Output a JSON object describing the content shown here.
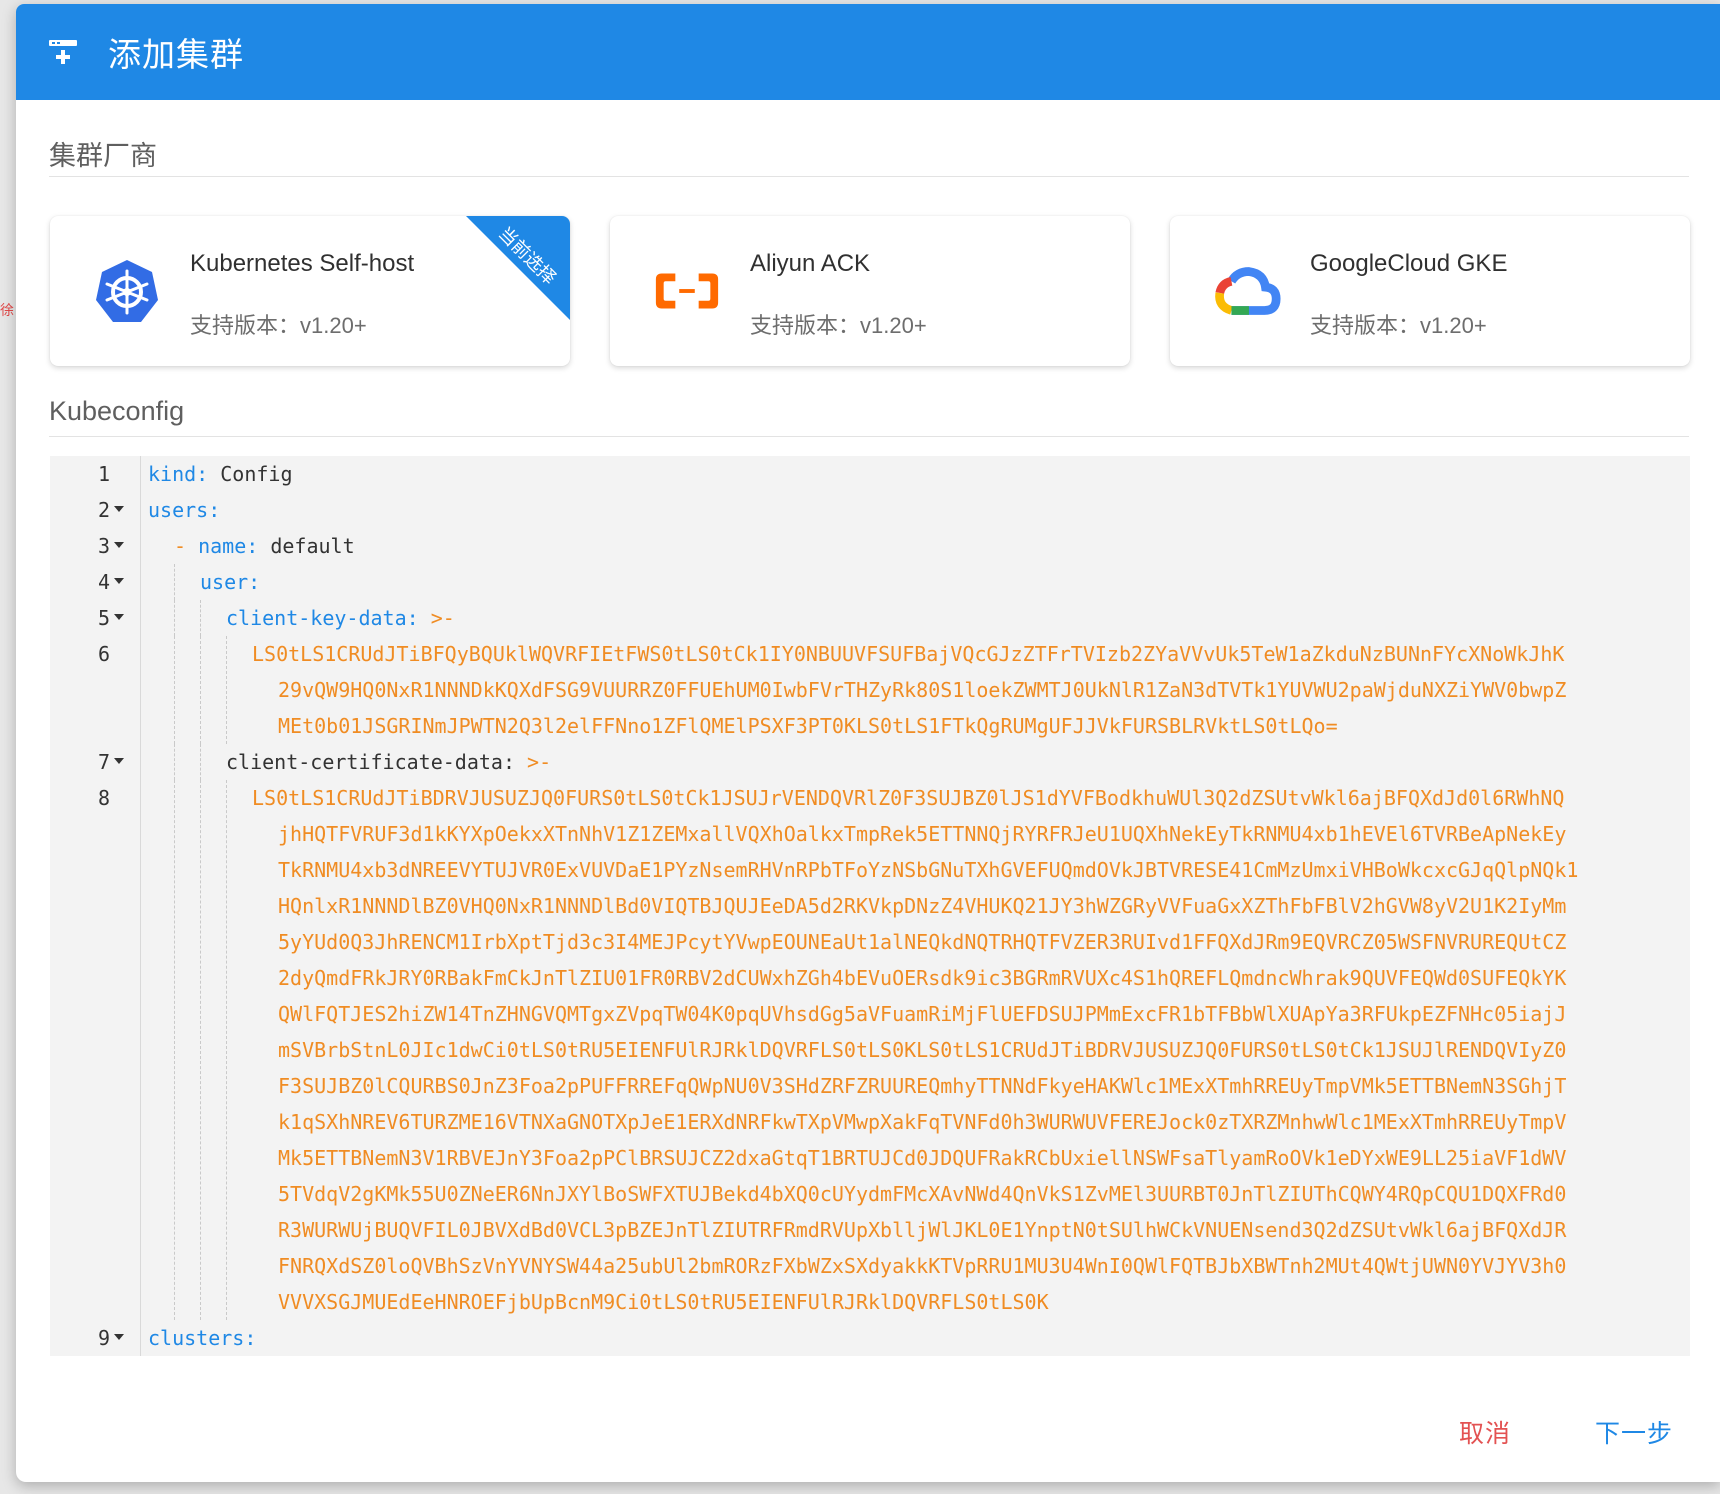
{
  "dialog": {
    "title": "添加集群",
    "title_icon": "add-server-icon"
  },
  "vendor_section": {
    "label": "集群厂商"
  },
  "vendors": [
    {
      "name": "Kubernetes Self-host",
      "version": "支持版本：v1.20+",
      "icon": "kubernetes-icon",
      "selected": true,
      "badge": "当前选择"
    },
    {
      "name": "Aliyun ACK",
      "version": "支持版本：v1.20+",
      "icon": "aliyun-icon",
      "selected": false
    },
    {
      "name": "GoogleCloud GKE",
      "version": "支持版本：v1.20+",
      "icon": "google-cloud-icon",
      "selected": false
    }
  ],
  "kubeconfig_section": {
    "label": "Kubeconfig"
  },
  "editor": {
    "line_numbers": [
      "1",
      "2",
      "3",
      "4",
      "5",
      "6",
      "7",
      "8",
      "9"
    ],
    "l1_key": "kind",
    "l1_colon": ":",
    "l1_val": " Config",
    "l2_key": "users",
    "l2_colon": ":",
    "l3_dash": "- ",
    "l3_key": "name",
    "l3_colon": ":",
    "l3_val": " default",
    "l4_key": "user",
    "l4_colon": ":",
    "l5_key": "client-key-data",
    "l5_colon": ":",
    "l5_val": " >-",
    "l6_lines": [
      "LS0tLS1CRUdJTiBFQyBQUklWQVRFIEtFWS0tLS0tCk1IY0NBUUVFSUFBajVQcGJzZTFrTVIzb2ZYaVVvUk5TeW1aZkduNzBUNnFYcXNoWkJhK",
      "29vQW9HQ0NxR1NNNDkKQXdFSG9VUURRZ0FFUEhUM0IwbFVrTHZyRk80S1loekZWMTJ0UkNlR1ZaN3dTVTk1YUVWU2paWjduNXZiYWV0bwpZ",
      "MEt0b01JSGRINmJPWTN2Q3l2elFFNno1ZFlQMElPSXF3PT0KLS0tLS1FTkQgRUMgUFJJVkFURSBLRVktLS0tLQo="
    ],
    "l7_key": "client-certificate-data",
    "l7_colon": ":",
    "l7_val": " >-",
    "l8_lines": [
      "LS0tLS1CRUdJTiBDRVJUSUZJQ0FURS0tLS0tCk1JSUJrVENDQVRlZ0F3SUJBZ0lJS1dYVFBodkhuWUl3Q2dZSUtvWkl6ajBFQXdJd0l6RWhNQ",
      "jhHQTFVRUF3d1kKYXpOekxXTnNhV1Z1ZEMxallVQXhOalkxTmpRek5ETTNNQjRYRFRJeU1UQXhNekEyTkRNMU4xb1hEVEl6TVRBeApNekEy",
      "TkRNMU4xb3dNREEVYTUJVR0ExVUVDaE1PYzNsemRHVnRPbTFoYzNSbGNuTXhGVEFUQmdOVkJBTVRESE41CmMzUmxiVHBoWkcxcGJqQlpNQk1",
      "HQnlxR1NNNDlBZ0VHQ0NxR1NNNDlBd0VIQTBJQUJEeDA5d2RKVkpDNzZ4VHUKQ21JY3hWZGRyVVFuaGxXZThFbFBlV2hGVW8yV2U1K2IyMm",
      "5yYUd0Q3JhRENCM1IrbXptTjd3c3I4MEJPcytYVwpEOUNEaUt1alNEQkdNQTRHQTFVZER3RUIvd1FFQXdJRm9EQVRCZ05WSFNVRUREQUtCZ",
      "2dyQmdFRkJRY0RBakFmCkJnTlZIU01FR0RBV2dCUWxhZGh4bEVuOERsdk9ic3BGRmRVUXc4S1hQREFLQmdncWhrak9QUVFEQWd0SUFEQkYK",
      "QWlFQTJES2hiZW14TnZHNGVQMTgxZVpqTW04K0pqUVhsdGg5aVFuamRiMjFlUEFDSUJPMmExcFR1bTFBbWlXUApYa3RFUkpEZFNHc05iajJ",
      "mSVBrbStnL0JIc1dwCi0tLS0tRU5EIENFUlRJRklDQVRFLS0tLS0KLS0tLS1CRUdJTiBDRVJUSUZJQ0FURS0tLS0tCk1JSUJlRENDQVIyZ0",
      "F3SUJBZ0lCQURBS0JnZ3Foa2pPUFFRREFqQWpNU0V3SHdZRFZRUUREQmhyTTNNdFkyeHAKWlc1MExXTmhRREUyTmpVMk5ETTBNemN3SGhjT",
      "k1qSXhNREV6TURZME16VTNXaGNOTXpJeE1ERXdNRFkwTXpVMwpXakFqTVNFd0h3WURWUVFEREJock0zTXRZMnhwWlc1MExXTmhRREUyTmpV",
      "Mk5ETTBNemN3V1RBVEJnY3Foa2pPClBRSUJCZ2dxaGtqT1BRTUJCd0JDQUFRakRCbUxiellNSWFsaTlyamRoOVk1eDYxWE9LL25iaVF1dWV",
      "5TVdqV2gKMk55U0ZNeER6NnJXYlBoSWFXTUJBekd4bXQ0cUYydmFMcXAvNWd4QnVkS1ZvMEl3UURBT0JnTlZIUThCQWY4RQpCQU1DQXFRd0",
      "R3WURWUjBUQVFIL0JBVXdBd0VCL3pBZEJnTlZIUTRFRmdRVUpXblljWlJKL0E1YnptN0tSUlhWCkVNUENsend3Q2dZSUtvWkl6ajBFQXdJR",
      "FNRQXdSZ0loQVBhSzVnYVNYSW44a25ubUl2bmRORzFXbWZxSXdyakkKTVpRRU1MU3U4WnI0QWlFQTBJbXBWTnh2MUt4QWtjUWN0YVJYV3h0",
      "VVVXSGJMUEdEeHNROEFjbUpBcnM9Ci0tLS0tRU5EIENFUlRJRklDQVRFLS0tLS0K"
    ],
    "l9_key": "clusters",
    "l9_colon": ":"
  },
  "footer": {
    "cancel": "取消",
    "next": "下一步"
  },
  "colors": {
    "primary": "#1f88e5",
    "accent_orange": "#f08c23",
    "danger": "#e35252"
  }
}
